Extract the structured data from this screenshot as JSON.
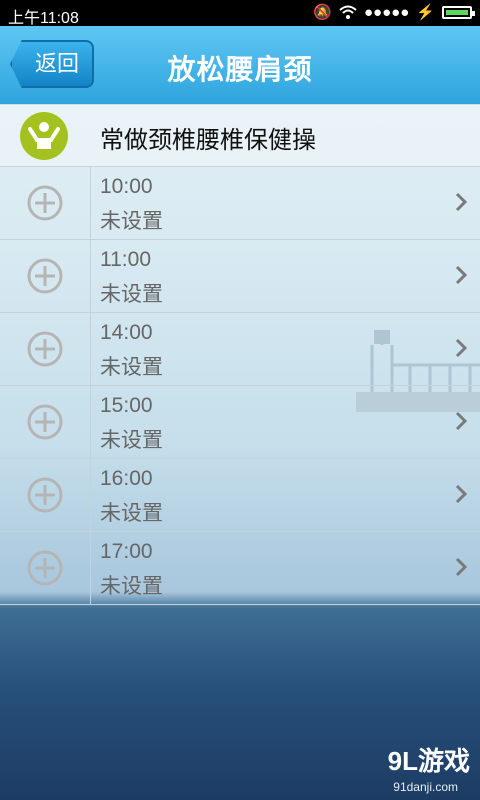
{
  "status_bar": {
    "time": "上午11:08",
    "signal": "●●●●●"
  },
  "header": {
    "back_label": "返回",
    "title": "放松腰肩颈"
  },
  "topic": {
    "label": "常做颈椎腰椎保健操",
    "logo_icon": "person-stretch-icon",
    "logo_color": "#a3c21f"
  },
  "reminders": [
    {
      "time": "10:00",
      "status": "未设置"
    },
    {
      "time": "11:00",
      "status": "未设置"
    },
    {
      "time": "14:00",
      "status": "未设置"
    },
    {
      "time": "15:00",
      "status": "未设置"
    },
    {
      "time": "16:00",
      "status": "未设置"
    },
    {
      "time": "17:00",
      "status": "未设置"
    }
  ],
  "watermark": {
    "brand": "9L游戏",
    "site": "91danji.com"
  }
}
